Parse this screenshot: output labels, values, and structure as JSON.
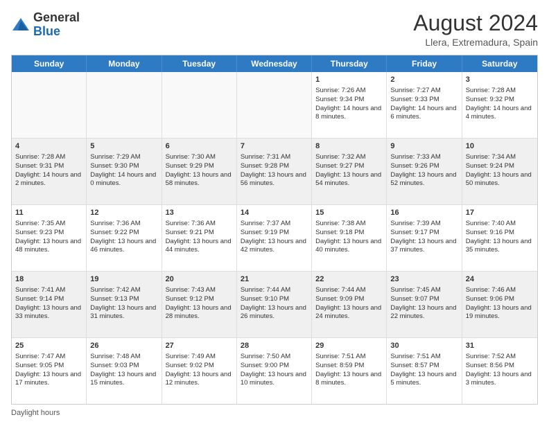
{
  "header": {
    "logo_general": "General",
    "logo_blue": "Blue",
    "month_year": "August 2024",
    "location": "Llera, Extremadura, Spain"
  },
  "days_of_week": [
    "Sunday",
    "Monday",
    "Tuesday",
    "Wednesday",
    "Thursday",
    "Friday",
    "Saturday"
  ],
  "footer": {
    "label": "Daylight hours"
  },
  "weeks": [
    [
      {
        "day": "",
        "sunrise": "",
        "sunset": "",
        "daylight": "",
        "empty": true
      },
      {
        "day": "",
        "sunrise": "",
        "sunset": "",
        "daylight": "",
        "empty": true
      },
      {
        "day": "",
        "sunrise": "",
        "sunset": "",
        "daylight": "",
        "empty": true
      },
      {
        "day": "",
        "sunrise": "",
        "sunset": "",
        "daylight": "",
        "empty": true
      },
      {
        "day": "1",
        "sunrise": "Sunrise: 7:26 AM",
        "sunset": "Sunset: 9:34 PM",
        "daylight": "Daylight: 14 hours and 8 minutes.",
        "empty": false
      },
      {
        "day": "2",
        "sunrise": "Sunrise: 7:27 AM",
        "sunset": "Sunset: 9:33 PM",
        "daylight": "Daylight: 14 hours and 6 minutes.",
        "empty": false
      },
      {
        "day": "3",
        "sunrise": "Sunrise: 7:28 AM",
        "sunset": "Sunset: 9:32 PM",
        "daylight": "Daylight: 14 hours and 4 minutes.",
        "empty": false
      }
    ],
    [
      {
        "day": "4",
        "sunrise": "Sunrise: 7:28 AM",
        "sunset": "Sunset: 9:31 PM",
        "daylight": "Daylight: 14 hours and 2 minutes.",
        "empty": false
      },
      {
        "day": "5",
        "sunrise": "Sunrise: 7:29 AM",
        "sunset": "Sunset: 9:30 PM",
        "daylight": "Daylight: 14 hours and 0 minutes.",
        "empty": false
      },
      {
        "day": "6",
        "sunrise": "Sunrise: 7:30 AM",
        "sunset": "Sunset: 9:29 PM",
        "daylight": "Daylight: 13 hours and 58 minutes.",
        "empty": false
      },
      {
        "day": "7",
        "sunrise": "Sunrise: 7:31 AM",
        "sunset": "Sunset: 9:28 PM",
        "daylight": "Daylight: 13 hours and 56 minutes.",
        "empty": false
      },
      {
        "day": "8",
        "sunrise": "Sunrise: 7:32 AM",
        "sunset": "Sunset: 9:27 PM",
        "daylight": "Daylight: 13 hours and 54 minutes.",
        "empty": false
      },
      {
        "day": "9",
        "sunrise": "Sunrise: 7:33 AM",
        "sunset": "Sunset: 9:26 PM",
        "daylight": "Daylight: 13 hours and 52 minutes.",
        "empty": false
      },
      {
        "day": "10",
        "sunrise": "Sunrise: 7:34 AM",
        "sunset": "Sunset: 9:24 PM",
        "daylight": "Daylight: 13 hours and 50 minutes.",
        "empty": false
      }
    ],
    [
      {
        "day": "11",
        "sunrise": "Sunrise: 7:35 AM",
        "sunset": "Sunset: 9:23 PM",
        "daylight": "Daylight: 13 hours and 48 minutes.",
        "empty": false
      },
      {
        "day": "12",
        "sunrise": "Sunrise: 7:36 AM",
        "sunset": "Sunset: 9:22 PM",
        "daylight": "Daylight: 13 hours and 46 minutes.",
        "empty": false
      },
      {
        "day": "13",
        "sunrise": "Sunrise: 7:36 AM",
        "sunset": "Sunset: 9:21 PM",
        "daylight": "Daylight: 13 hours and 44 minutes.",
        "empty": false
      },
      {
        "day": "14",
        "sunrise": "Sunrise: 7:37 AM",
        "sunset": "Sunset: 9:19 PM",
        "daylight": "Daylight: 13 hours and 42 minutes.",
        "empty": false
      },
      {
        "day": "15",
        "sunrise": "Sunrise: 7:38 AM",
        "sunset": "Sunset: 9:18 PM",
        "daylight": "Daylight: 13 hours and 40 minutes.",
        "empty": false
      },
      {
        "day": "16",
        "sunrise": "Sunrise: 7:39 AM",
        "sunset": "Sunset: 9:17 PM",
        "daylight": "Daylight: 13 hours and 37 minutes.",
        "empty": false
      },
      {
        "day": "17",
        "sunrise": "Sunrise: 7:40 AM",
        "sunset": "Sunset: 9:16 PM",
        "daylight": "Daylight: 13 hours and 35 minutes.",
        "empty": false
      }
    ],
    [
      {
        "day": "18",
        "sunrise": "Sunrise: 7:41 AM",
        "sunset": "Sunset: 9:14 PM",
        "daylight": "Daylight: 13 hours and 33 minutes.",
        "empty": false
      },
      {
        "day": "19",
        "sunrise": "Sunrise: 7:42 AM",
        "sunset": "Sunset: 9:13 PM",
        "daylight": "Daylight: 13 hours and 31 minutes.",
        "empty": false
      },
      {
        "day": "20",
        "sunrise": "Sunrise: 7:43 AM",
        "sunset": "Sunset: 9:12 PM",
        "daylight": "Daylight: 13 hours and 28 minutes.",
        "empty": false
      },
      {
        "day": "21",
        "sunrise": "Sunrise: 7:44 AM",
        "sunset": "Sunset: 9:10 PM",
        "daylight": "Daylight: 13 hours and 26 minutes.",
        "empty": false
      },
      {
        "day": "22",
        "sunrise": "Sunrise: 7:44 AM",
        "sunset": "Sunset: 9:09 PM",
        "daylight": "Daylight: 13 hours and 24 minutes.",
        "empty": false
      },
      {
        "day": "23",
        "sunrise": "Sunrise: 7:45 AM",
        "sunset": "Sunset: 9:07 PM",
        "daylight": "Daylight: 13 hours and 22 minutes.",
        "empty": false
      },
      {
        "day": "24",
        "sunrise": "Sunrise: 7:46 AM",
        "sunset": "Sunset: 9:06 PM",
        "daylight": "Daylight: 13 hours and 19 minutes.",
        "empty": false
      }
    ],
    [
      {
        "day": "25",
        "sunrise": "Sunrise: 7:47 AM",
        "sunset": "Sunset: 9:05 PM",
        "daylight": "Daylight: 13 hours and 17 minutes.",
        "empty": false
      },
      {
        "day": "26",
        "sunrise": "Sunrise: 7:48 AM",
        "sunset": "Sunset: 9:03 PM",
        "daylight": "Daylight: 13 hours and 15 minutes.",
        "empty": false
      },
      {
        "day": "27",
        "sunrise": "Sunrise: 7:49 AM",
        "sunset": "Sunset: 9:02 PM",
        "daylight": "Daylight: 13 hours and 12 minutes.",
        "empty": false
      },
      {
        "day": "28",
        "sunrise": "Sunrise: 7:50 AM",
        "sunset": "Sunset: 9:00 PM",
        "daylight": "Daylight: 13 hours and 10 minutes.",
        "empty": false
      },
      {
        "day": "29",
        "sunrise": "Sunrise: 7:51 AM",
        "sunset": "Sunset: 8:59 PM",
        "daylight": "Daylight: 13 hours and 8 minutes.",
        "empty": false
      },
      {
        "day": "30",
        "sunrise": "Sunrise: 7:51 AM",
        "sunset": "Sunset: 8:57 PM",
        "daylight": "Daylight: 13 hours and 5 minutes.",
        "empty": false
      },
      {
        "day": "31",
        "sunrise": "Sunrise: 7:52 AM",
        "sunset": "Sunset: 8:56 PM",
        "daylight": "Daylight: 13 hours and 3 minutes.",
        "empty": false
      }
    ]
  ]
}
